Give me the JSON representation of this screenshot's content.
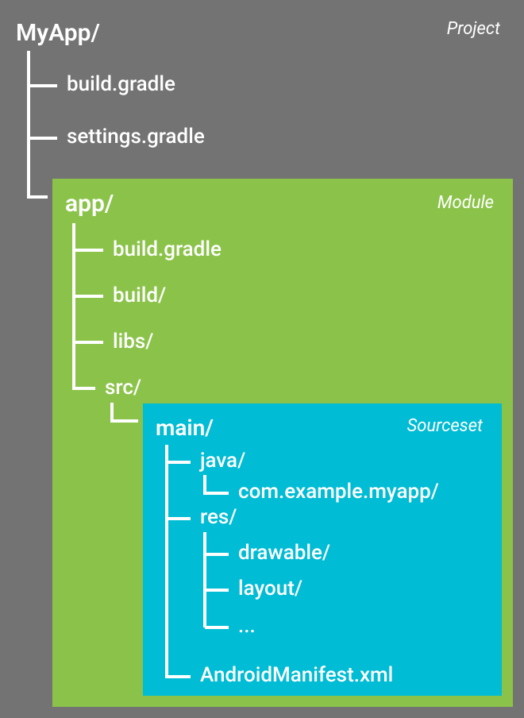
{
  "project": {
    "label": "Project",
    "name": "MyApp/",
    "children": [
      "build.gradle",
      "settings.gradle"
    ]
  },
  "module": {
    "label": "Module",
    "name": "app/",
    "children": [
      "build.gradle",
      "build/",
      "libs/",
      "src/"
    ]
  },
  "sourceset": {
    "label": "Sourceset",
    "name": "main/",
    "children": {
      "java": "java/",
      "java_pkg": "com.example.myapp/",
      "res": "res/",
      "res_children": [
        "drawable/",
        "layout/",
        "..."
      ],
      "manifest": "AndroidManifest.xml"
    }
  }
}
